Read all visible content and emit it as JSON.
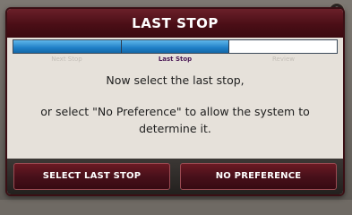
{
  "dialog": {
    "title": "LAST STOP",
    "progress": {
      "steps": [
        "Next Stop",
        "Last Stop",
        "Review"
      ],
      "completed_fraction": 0.667,
      "current_step": "Last Stop"
    },
    "message_line1": "Now select the last stop,",
    "message_line2": "or select \"No Preference\" to allow the system to determine it.",
    "buttons": {
      "select_last_stop": "SELECT LAST STOP",
      "no_preference": "NO PREFERENCE"
    }
  },
  "colors": {
    "title_bar": "#4a0e16",
    "progress_fill": "#1f7fc7",
    "button": "#48101a",
    "dialog_bg": "#e6e1da"
  }
}
